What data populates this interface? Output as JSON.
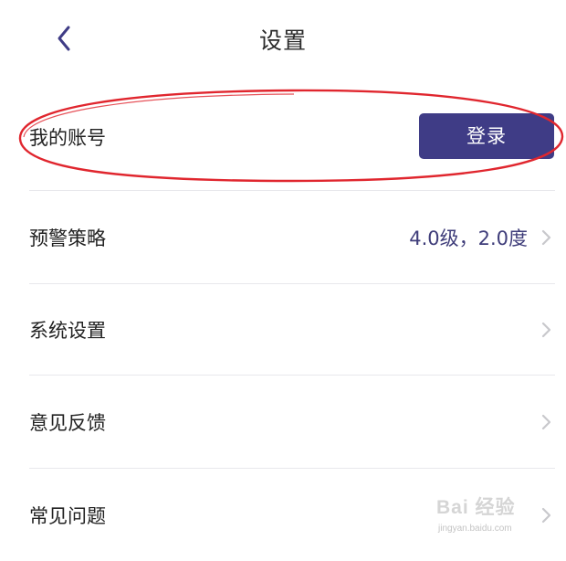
{
  "header": {
    "title": "设置",
    "back_icon": "chevron-left-icon"
  },
  "account": {
    "label": "我的账号",
    "login_label": "登录"
  },
  "rows": [
    {
      "label": "预警策略",
      "value": "4.0级，2.0度",
      "icon": "chevron-right-icon"
    },
    {
      "label": "系统设置",
      "value": "",
      "icon": "chevron-right-icon"
    },
    {
      "label": "意见反馈",
      "value": "",
      "icon": "chevron-right-icon"
    },
    {
      "label": "常见问题",
      "value": "",
      "icon": "chevron-right-icon"
    }
  ],
  "watermark": {
    "text": "Bai 经验",
    "sub": "jingyan.baidu.com"
  },
  "colors": {
    "accent": "#3f3c86",
    "value_text": "#3f3d7a",
    "highlight": "#e0262e",
    "divider": "#e8e8ec",
    "chevron": "#c8c8cc"
  }
}
